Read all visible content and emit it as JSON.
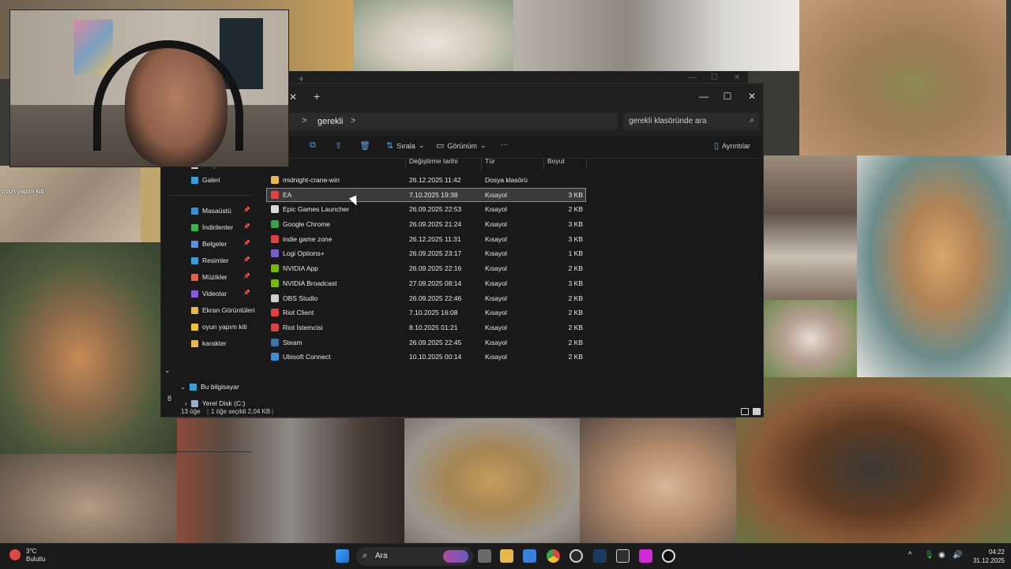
{
  "background": {
    "sidebar_caption": "oyun yapım kiti"
  },
  "back_window": {
    "plus": "+",
    "controls": [
      "—",
      "☐",
      "✕"
    ]
  },
  "explorer": {
    "tab_close": "✕",
    "new_tab": "+",
    "window_controls": {
      "minimize": "—",
      "maximize": "☐",
      "close": "✕"
    },
    "address": {
      "breadcrumb": "gerekli",
      "chevron": ">"
    },
    "search": {
      "placeholder": "gerekli klasöründe ara"
    },
    "commands": {
      "sort": "Sırala",
      "view": "Görünüm",
      "more": "···",
      "details": "Ayrıntılar"
    },
    "nav": {
      "top_partial": "Giriş",
      "gallery": "Galeri",
      "pinned": [
        {
          "label": "Masaüstü",
          "color": "#3a8fd9"
        },
        {
          "label": "İndirilenler",
          "color": "#3fb34f"
        },
        {
          "label": "Belgeler",
          "color": "#5a8ed8"
        },
        {
          "label": "Resimler",
          "color": "#3a9fd9"
        },
        {
          "label": "Müzikler",
          "color": "#e0604a"
        },
        {
          "label": "Videolar",
          "color": "#8a5ad8"
        },
        {
          "label": "Ekran Görüntüleri",
          "color": "#e8b84a"
        },
        {
          "label": "oyun yapım kiti",
          "color": "#f0c030"
        },
        {
          "label": "karakter",
          "color": "#e8b84a"
        }
      ],
      "this_pc": "Bu bilgisayar",
      "local_disk": "Yerel Disk (C:)",
      "pin_glyph": "📌"
    },
    "columns": {
      "modified": "Değiştirme tarihi",
      "type": "Tür",
      "size": "Boyut"
    },
    "files": [
      {
        "name": "midnight-crane-win",
        "date": "26.12.2025 11:42",
        "type": "Dosya klasörü",
        "size": "",
        "icon": "folder-icon",
        "color": "#e8b84a"
      },
      {
        "name": "EA",
        "date": "7.10.2025 19:38",
        "type": "Kısayol",
        "size": "3 KB",
        "icon": "ea-icon",
        "color": "#e04040",
        "selected": true
      },
      {
        "name": "Epic Games Launcher",
        "date": "26.09.2025 22:53",
        "type": "Kısayol",
        "size": "2 KB",
        "icon": "epic-icon",
        "color": "#d8d8d8"
      },
      {
        "name": "Google Chrome",
        "date": "26.09.2025 21:24",
        "type": "Kısayol",
        "size": "3 KB",
        "icon": "chrome-icon",
        "color": "#3aa04a"
      },
      {
        "name": "indie game zone",
        "date": "26.12.2025 11:31",
        "type": "Kısayol",
        "size": "3 KB",
        "icon": "indie-icon",
        "color": "#e04040"
      },
      {
        "name": "Logi Options+",
        "date": "26.09.2025 23:17",
        "type": "Kısayol",
        "size": "1 KB",
        "icon": "logi-icon",
        "color": "#7a5ad8"
      },
      {
        "name": "NVIDIA App",
        "date": "26.09.2025 22:16",
        "type": "Kısayol",
        "size": "2 KB",
        "icon": "nvidia-icon",
        "color": "#76b900"
      },
      {
        "name": "NVIDIA Broadcast",
        "date": "27.09.2025 08:14",
        "type": "Kısayol",
        "size": "3 KB",
        "icon": "nvidia-icon",
        "color": "#76b900"
      },
      {
        "name": "OBS Studio",
        "date": "26.09.2025 22:46",
        "type": "Kısayol",
        "size": "2 KB",
        "icon": "obs-icon",
        "color": "#cfcfcf"
      },
      {
        "name": "Riot Client",
        "date": "7.10.2025 16:08",
        "type": "Kısayol",
        "size": "2 KB",
        "icon": "riot-icon",
        "color": "#e04040"
      },
      {
        "name": "Riot İstemcisi",
        "date": "8.10.2025 01:21",
        "type": "Kısayol",
        "size": "2 KB",
        "icon": "riot-icon",
        "color": "#e04040"
      },
      {
        "name": "Steam",
        "date": "26.09.2025 22:45",
        "type": "Kısayol",
        "size": "2 KB",
        "icon": "steam-icon",
        "color": "#3a6fb0"
      },
      {
        "name": "Ubisoft Connect",
        "date": "10.10.2025 00:14",
        "type": "Kısayol",
        "size": "2 KB",
        "icon": "ubisoft-icon",
        "color": "#3a8fd9"
      }
    ],
    "status": {
      "count": "13 öğe",
      "selected": "1 öğe seçildi 2,04 KB"
    },
    "side_digit": "8"
  },
  "taskbar": {
    "weather_temp": "3°C",
    "weather_desc": "Bulutlu",
    "search_label": "Ara",
    "time": "04:22",
    "date": "31.12.2025",
    "tray_up": "^",
    "icons": [
      "windows-start-icon",
      "file-explorer-icon",
      "microsoft-store-icon",
      "chrome-icon",
      "obs-icon",
      "steam-icon",
      "epic-games-icon",
      "app-icon",
      "unreal-icon"
    ]
  }
}
